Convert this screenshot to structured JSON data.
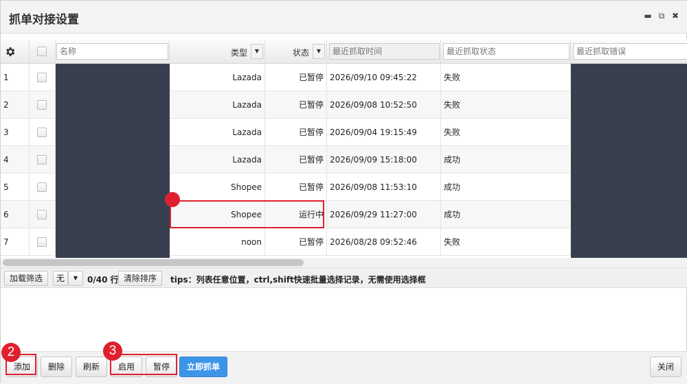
{
  "window": {
    "title": "抓单对接设置",
    "buttons": {
      "minimize": "▬",
      "restore": "⧉",
      "close": "✖"
    }
  },
  "grid": {
    "columns": {
      "name_placeholder": "名称",
      "type": "类型",
      "status": "状态",
      "last_time_placeholder": "最近抓取时间",
      "last_status_placeholder": "最近抓取状态",
      "last_error_placeholder": "最近抓取错误"
    },
    "rows": [
      {
        "num": "1",
        "type": "Lazada",
        "status": "已暂停",
        "time": "2026/09/10 09:45:22",
        "result": "失败"
      },
      {
        "num": "2",
        "type": "Lazada",
        "status": "已暂停",
        "time": "2026/09/08 10:52:50",
        "result": "失败"
      },
      {
        "num": "3",
        "type": "Lazada",
        "status": "已暂停",
        "time": "2026/09/04 19:15:49",
        "result": "失败"
      },
      {
        "num": "4",
        "type": "Lazada",
        "status": "已暂停",
        "time": "2026/09/09 15:18:00",
        "result": "成功"
      },
      {
        "num": "5",
        "type": "Shopee",
        "status": "已暂停",
        "time": "2026/09/08 11:53:10",
        "result": "成功"
      },
      {
        "num": "6",
        "type": "Shopee",
        "status": "运行中",
        "time": "2026/09/29 11:27:00",
        "result": "成功"
      },
      {
        "num": "7",
        "type": "noon",
        "status": "已暂停",
        "time": "2026/08/28 09:52:46",
        "result": "失败"
      }
    ]
  },
  "pager": {
    "load_filter": "加载筛选",
    "filter_value": "无",
    "row_count": "0/40 行",
    "clear_sort": "清除排序",
    "tips": "tips：列表任意位置，ctrl,shift快速批量选择记录，无需使用选择框"
  },
  "footer": {
    "add": "添加",
    "delete": "删除",
    "refresh": "刷新",
    "enable": "启用",
    "pause": "暂停",
    "fetch_now": "立即抓单",
    "close": "关闭"
  },
  "callouts": {
    "two": "2",
    "three": "3"
  }
}
